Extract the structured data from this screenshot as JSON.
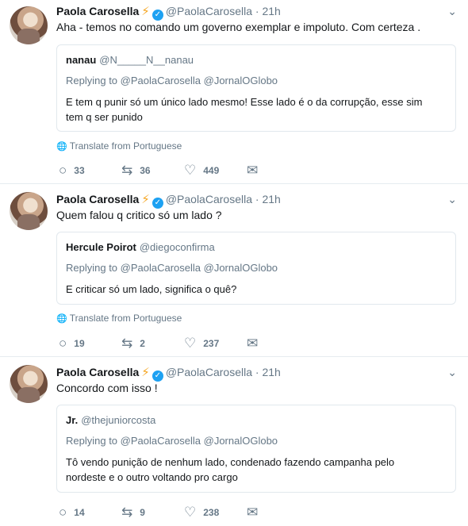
{
  "author": {
    "name": "Paola Carosella",
    "handle": "@PaolaCarosella",
    "dot": "·",
    "time": "21h"
  },
  "translate_label": "Translate from Portuguese",
  "tweets": [
    {
      "text": "Aha - temos no comando um governo exemplar e impoluto. Com certeza .",
      "quote": {
        "name": "nanau",
        "handle": "@N_____N__nanau",
        "reply_to": "Replying to @PaolaCarosella @JornalOGlobo",
        "text_line1": "E tem q punir só um único lado mesmo! Esse lado é o da corrupção, esse sim",
        "text_line2": "tem q ser punido"
      },
      "replies": "33",
      "retweets": "36",
      "likes": "449"
    },
    {
      "text": "Quem falou q critico só um lado ?",
      "quote": {
        "name": "Hercule Poirot",
        "handle": "@diegoconfirma",
        "reply_to": "Replying to @PaolaCarosella @JornalOGlobo",
        "text_line1": "E criticar só um lado, significa o quê?",
        "text_line2": ""
      },
      "replies": "19",
      "retweets": "2",
      "likes": "237"
    },
    {
      "text": "Concordo com isso !",
      "quote": {
        "name": "Jr.",
        "handle": "@thejuniorcosta",
        "reply_to": "Replying to @PaolaCarosella @JornalOGlobo",
        "text_line1": "Tô vendo punição de nenhum lado, condenado fazendo campanha pelo",
        "text_line2": "nordeste e o outro voltando pro cargo"
      },
      "replies": "14",
      "retweets": "9",
      "likes": "238"
    }
  ],
  "icons": {
    "bolt": "⚡",
    "verified": "✓",
    "caret": "⌄",
    "globe": "🌐",
    "reply": "○",
    "retweet": "⇆",
    "like": "♡",
    "message": "✉"
  },
  "colors": {
    "accent": "#1da1f2",
    "muted": "#657786",
    "border": "#e6ecf0",
    "bolt": "#f5a623"
  }
}
